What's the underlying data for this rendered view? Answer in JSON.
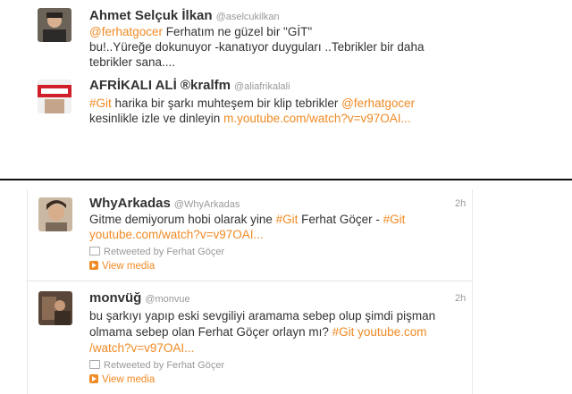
{
  "tweets_top": [
    {
      "name": "Ahmet Selçuk İlkan",
      "handle": "@aselcukilkan",
      "line1_mention": "@ferhatgocer",
      "line1_rest": " Ferhatım ne güzel bir \"GİT\"",
      "line2": "bu!..Yüreğe dokunuyor -kanatıyor duyguları ..Tebrikler  bir daha",
      "line3": "tebrikler sana...."
    },
    {
      "name": "AFRİKALI ALİ ®kralfm",
      "handle": "@aliafrikalali",
      "line1_hashtag": "#Git",
      "line1_mid": " harika bir şarkı muhteşem bir klip tebrikler ",
      "line1_mention": "@ferhatgocer",
      "line2_text": "kesinlikle izle ve dinleyin  ",
      "line2_link": "m.youtube.com/watch?v=v97OAI..."
    }
  ],
  "tweets_bottom": [
    {
      "name": "WhyArkadas",
      "handle": "@WhyArkadas",
      "time": "2h",
      "line1_text": "Gitme demiyorum hobi olarak yine ",
      "line1_hashtag": "#Git",
      "line1_mid": "  Ferhat Göçer - ",
      "line1_hashtag2": "#Git",
      "line2_link": "youtube.com/watch?v=v97OAI...",
      "retweeted": "Retweeted by Ferhat Göçer",
      "view_media": "View media"
    },
    {
      "name": "monvüğ",
      "handle": "@monvue",
      "time": "2h",
      "line1": "bu şarkıyı yapıp eski sevgiliyi aramama sebep olup şimdi pişman",
      "line2_text": "olmama sebep olan Ferhat Göçer orlayn mı? ",
      "line2_hashtag": "#Git",
      "line2_link": " youtube.com",
      "line3_link": "/watch?v=v97OAI...",
      "retweeted": "Retweeted by Ferhat Göçer",
      "view_media": "View media"
    }
  ],
  "colors": {
    "link": "#f08a24",
    "text": "#333333",
    "muted": "#999999"
  }
}
